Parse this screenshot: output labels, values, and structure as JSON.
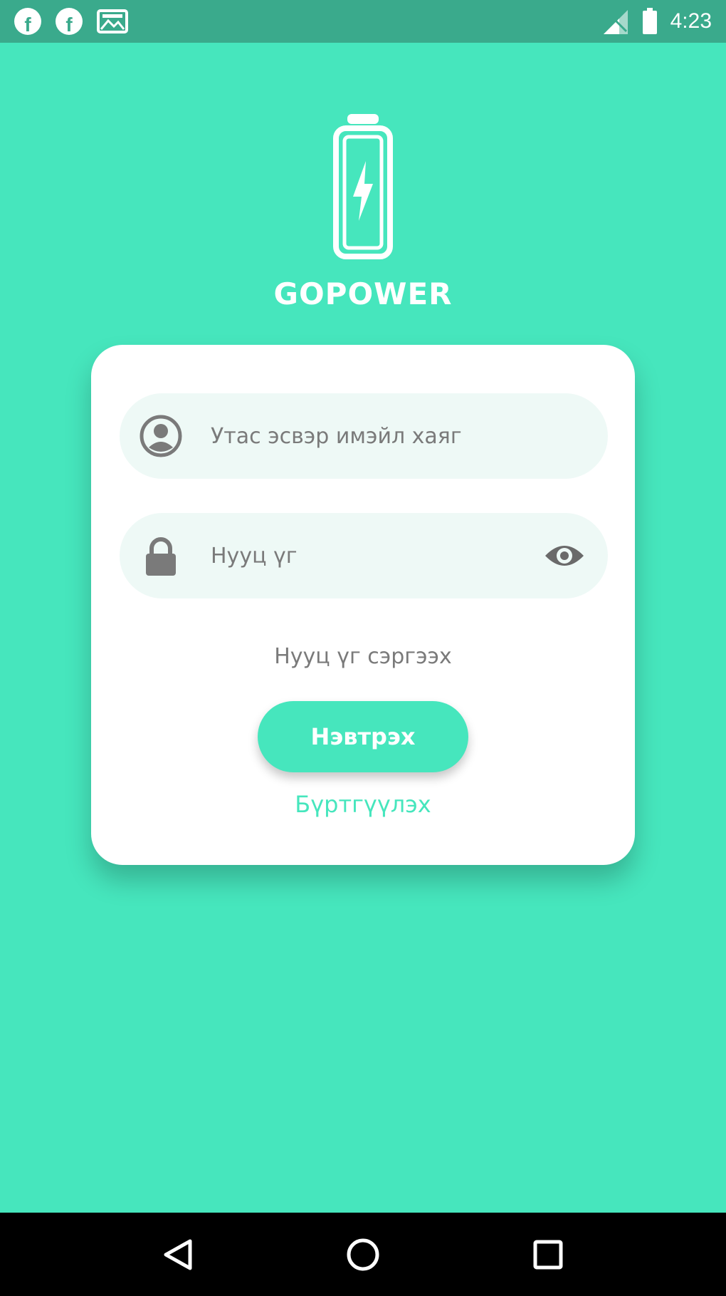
{
  "status_bar": {
    "time": "4:23",
    "icons": [
      "facebook-icon",
      "facebook-icon",
      "gallery-icon",
      "signal-icon",
      "battery-icon"
    ]
  },
  "app": {
    "name": "GOPOWER",
    "logo": "battery-bolt-icon"
  },
  "login": {
    "username_placeholder": "Утас эсвэр имэйл хаяг",
    "password_placeholder": "Нууц үг",
    "forgot_label": "Нууц үг сэргээх",
    "login_label": "Нэвтрэх",
    "register_label": "Бүртгүүлэх"
  },
  "nav": {
    "icons": [
      "back-icon",
      "home-icon",
      "recents-icon"
    ]
  },
  "colors": {
    "background": "#46e6bd",
    "status_bar": "#3aaa8c",
    "field_bg": "#eef9f6",
    "icon_gray": "#7a7a7a",
    "accent": "#46e6bd"
  }
}
